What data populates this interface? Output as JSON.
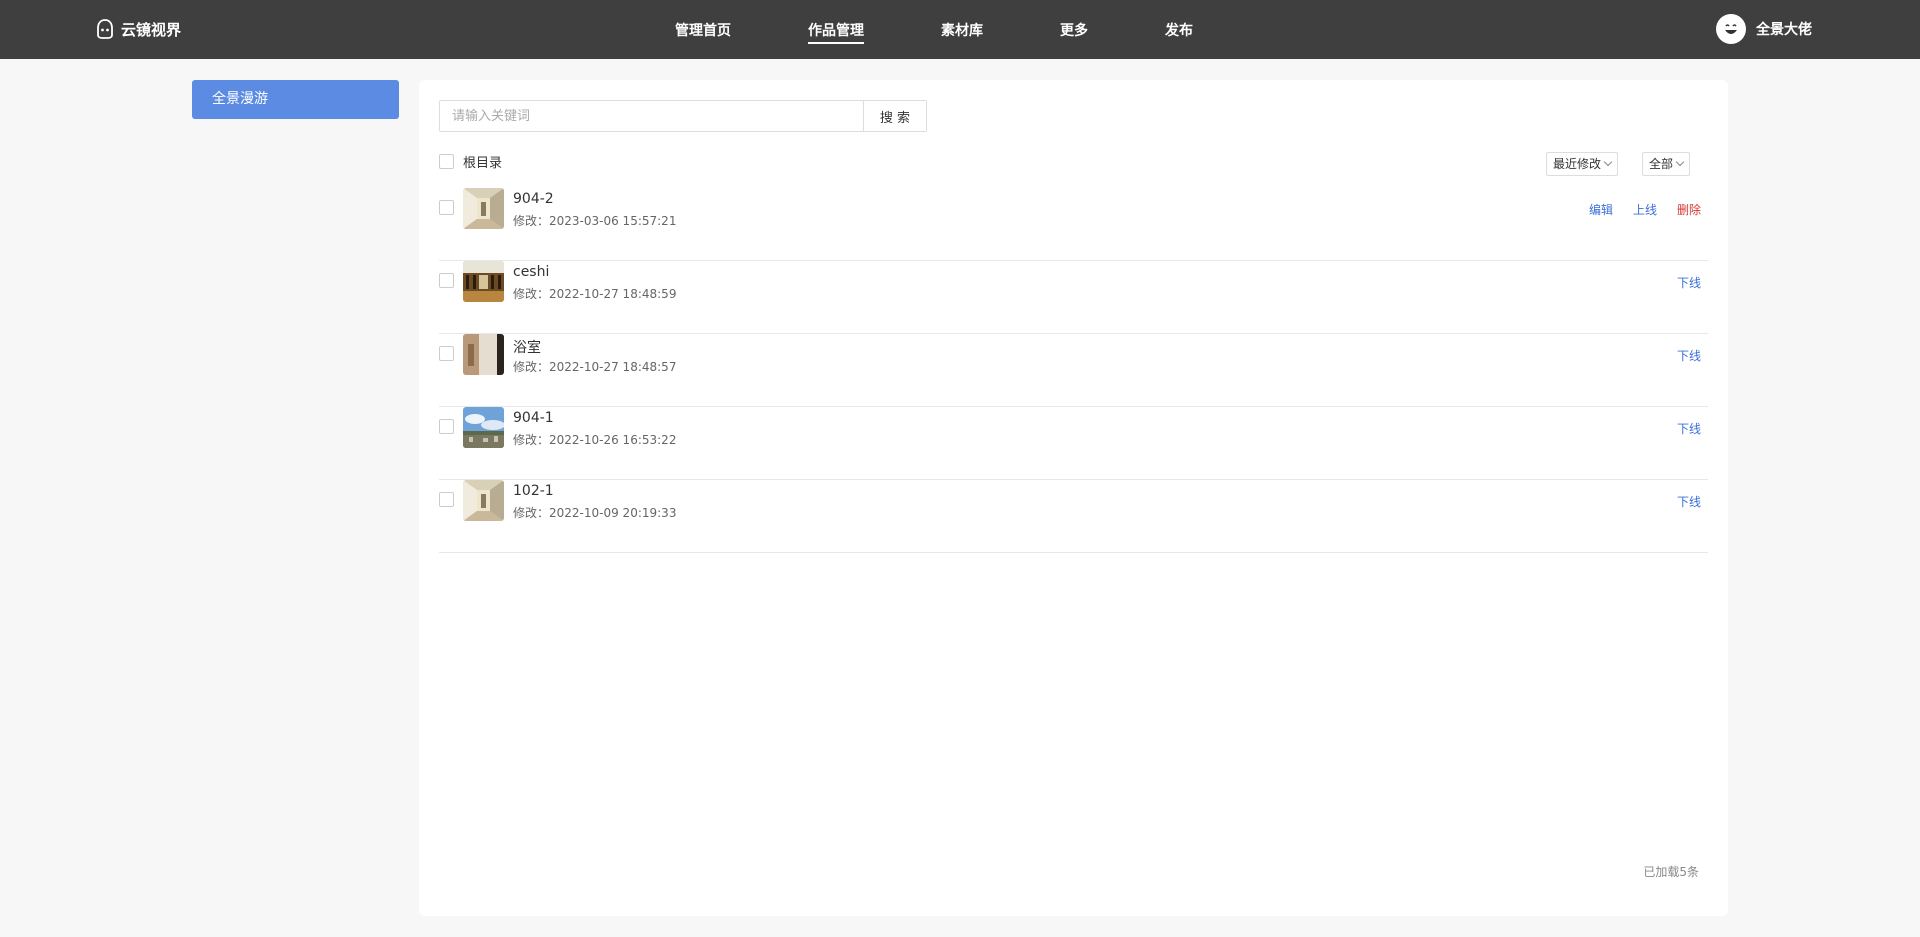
{
  "brand": {
    "name": "云镜视界",
    "icon": "logo-icon"
  },
  "nav": {
    "items": [
      {
        "label": "管理首页",
        "active": false
      },
      {
        "label": "作品管理",
        "active": true
      },
      {
        "label": "素材库",
        "active": false
      },
      {
        "label": "更多",
        "active": false
      },
      {
        "label": "发布",
        "active": false
      }
    ]
  },
  "user": {
    "name": "全景大佬",
    "icon": "smiley-avatar-icon"
  },
  "sidebar": {
    "items": [
      {
        "label": "全景漫游",
        "active": true
      }
    ]
  },
  "search": {
    "placeholder": "请输入关键词",
    "button_label": "搜 索"
  },
  "list": {
    "root_label": "根目录",
    "sort_label": "最近修改",
    "filter_label": "全部",
    "items": [
      {
        "title": "904-2",
        "modified": "修改：2023-03-06 15:57:21",
        "thumb": "hallway",
        "actions": [
          "编辑",
          "上线",
          "删除"
        ]
      },
      {
        "title": "ceshi",
        "modified": "修改：2022-10-27 18:48:59",
        "thumb": "library",
        "actions": [
          "下线"
        ]
      },
      {
        "title": "浴室",
        "modified": "修改：2022-10-27 18:48:57",
        "thumb": "bathroom",
        "actions": [
          "下线"
        ]
      },
      {
        "title": "904-1",
        "modified": "修改：2022-10-26 16:53:22",
        "thumb": "sky",
        "actions": [
          "下线"
        ]
      },
      {
        "title": "102-1",
        "modified": "修改：2022-10-09 20:19:33",
        "thumb": "hallway",
        "actions": [
          "下线"
        ]
      }
    ],
    "footer_text": "已加载5条"
  },
  "colors": {
    "topbar": "#3f3f3f",
    "accent": "#5b8be3",
    "link": "#3a6fd8",
    "danger": "#d83838"
  }
}
